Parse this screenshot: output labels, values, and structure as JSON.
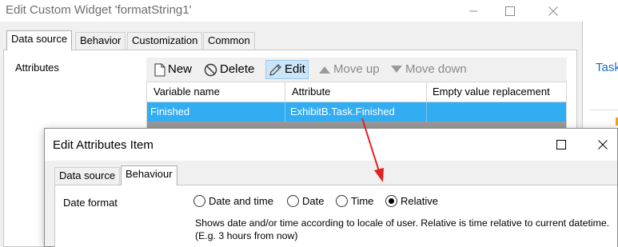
{
  "outer_dialog": {
    "title": "Edit Custom Widget 'formatString1'",
    "tabs": [
      {
        "label": "Data source",
        "active": true
      },
      {
        "label": "Behavior",
        "active": false
      },
      {
        "label": "Customization",
        "active": false
      },
      {
        "label": "Common",
        "active": false
      }
    ],
    "attributes_label": "Attributes",
    "toolbar": {
      "new_label": "New",
      "delete_label": "Delete",
      "edit_label": "Edit",
      "move_up_label": "Move up",
      "move_down_label": "Move down"
    },
    "grid": {
      "columns": [
        "Variable name",
        "Attribute",
        "Empty value replacement"
      ],
      "rows": [
        {
          "variable_name": "Finished",
          "attribute": "ExhibitB.Task.Finished",
          "empty_value_replacement": "",
          "selected": true
        }
      ]
    }
  },
  "background": {
    "task_link": "Task"
  },
  "inner_dialog": {
    "title": "Edit Attributes Item",
    "tabs": [
      {
        "label": "Data source",
        "active": false
      },
      {
        "label": "Behaviour",
        "active": true
      }
    ],
    "date_format_label": "Date format",
    "date_format_options": [
      {
        "label": "Date and time",
        "checked": false
      },
      {
        "label": "Date",
        "checked": false
      },
      {
        "label": "Time",
        "checked": false
      },
      {
        "label": "Relative",
        "checked": true
      }
    ],
    "description": "Shows date and/or time according to locale of user. Relative is time relative to current datetime. (E.g. 3 hours from now)"
  },
  "colors": {
    "selection": "#33adf2",
    "annotation_arrow": "#e02020"
  },
  "icons": [
    "new-file-icon",
    "delete-icon",
    "edit-pencil-icon",
    "move-up-icon",
    "move-down-icon",
    "minimize-icon",
    "maximize-icon",
    "close-icon"
  ]
}
